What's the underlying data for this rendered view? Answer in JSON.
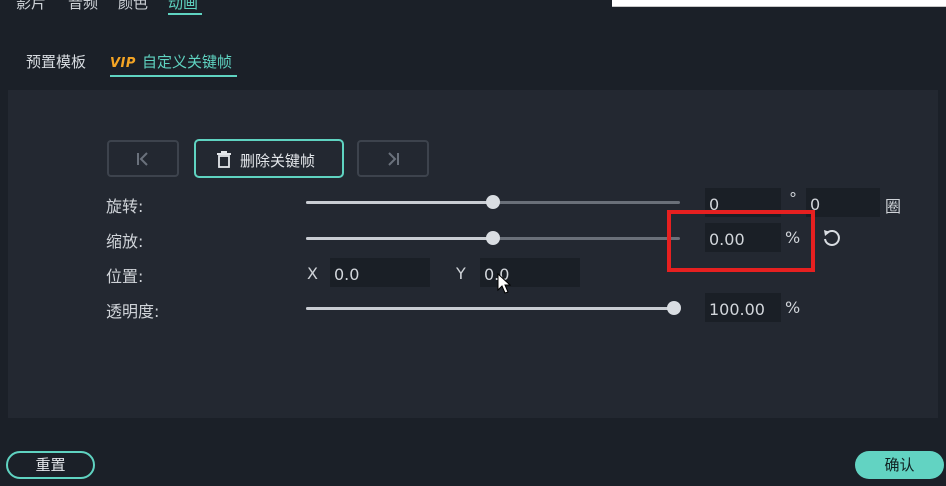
{
  "top_tabs": [
    "影片",
    "音频",
    "颜色",
    "动画"
  ],
  "sub_tabs": {
    "preset": "预置模板",
    "vip": "VIP",
    "custom": "自定义关键帧"
  },
  "keyframe_toolbar": {
    "prev_icon": "prev-keyframe-icon",
    "delete_label": "删除关键帧",
    "delete_icon": "trash-icon",
    "next_icon": "next-keyframe-icon"
  },
  "rotation": {
    "label": "旋转:",
    "slider_fraction": 0.5,
    "degrees_value": "0",
    "degree_unit": "°",
    "turns_value": "0",
    "turns_unit": "圈"
  },
  "scale": {
    "label": "缩放:",
    "slider_fraction": 0.5,
    "value": "0.00",
    "unit": "%",
    "reset_icon": "reset-icon"
  },
  "position": {
    "label": "位置:",
    "x_label": "X",
    "x_value": "0.0",
    "y_label": "Y",
    "y_value": "0.0"
  },
  "opacity": {
    "label": "透明度:",
    "slider_fraction": 1.0,
    "value": "100.00",
    "unit": "%"
  },
  "footer": {
    "reset_label": "重置",
    "confirm_label": "确认"
  },
  "colors": {
    "accent": "#5fd3c1",
    "vip": "#f5a524",
    "highlight": "#e62020"
  }
}
